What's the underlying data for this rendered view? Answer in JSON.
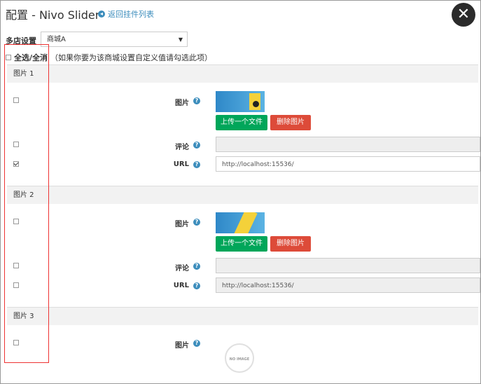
{
  "header": {
    "title": "配置 - Nivo Slider",
    "back_link": "返回挂件列表"
  },
  "store": {
    "label": "多店设置",
    "selected": "商城A"
  },
  "select_all": {
    "label": "全选/全消",
    "hint": "（如果你要为该商城设置自定义值请勾选此项）"
  },
  "labels": {
    "picture": "图片",
    "comment": "评论",
    "url": "URL"
  },
  "buttons": {
    "upload": "上传一个文件",
    "delete": "删除图片"
  },
  "groups": [
    {
      "title": "图片 1",
      "url_value": "http://localhost:15536/",
      "url_checked": true
    },
    {
      "title": "图片 2",
      "url_value": "http://localhost:15536/",
      "url_checked": false
    },
    {
      "title": "图片 3"
    }
  ],
  "no_image_text": "NO IMAGE",
  "icons": {
    "close": "close-icon",
    "back": "arrow-left-circle-icon",
    "help": "question-circle-icon"
  }
}
